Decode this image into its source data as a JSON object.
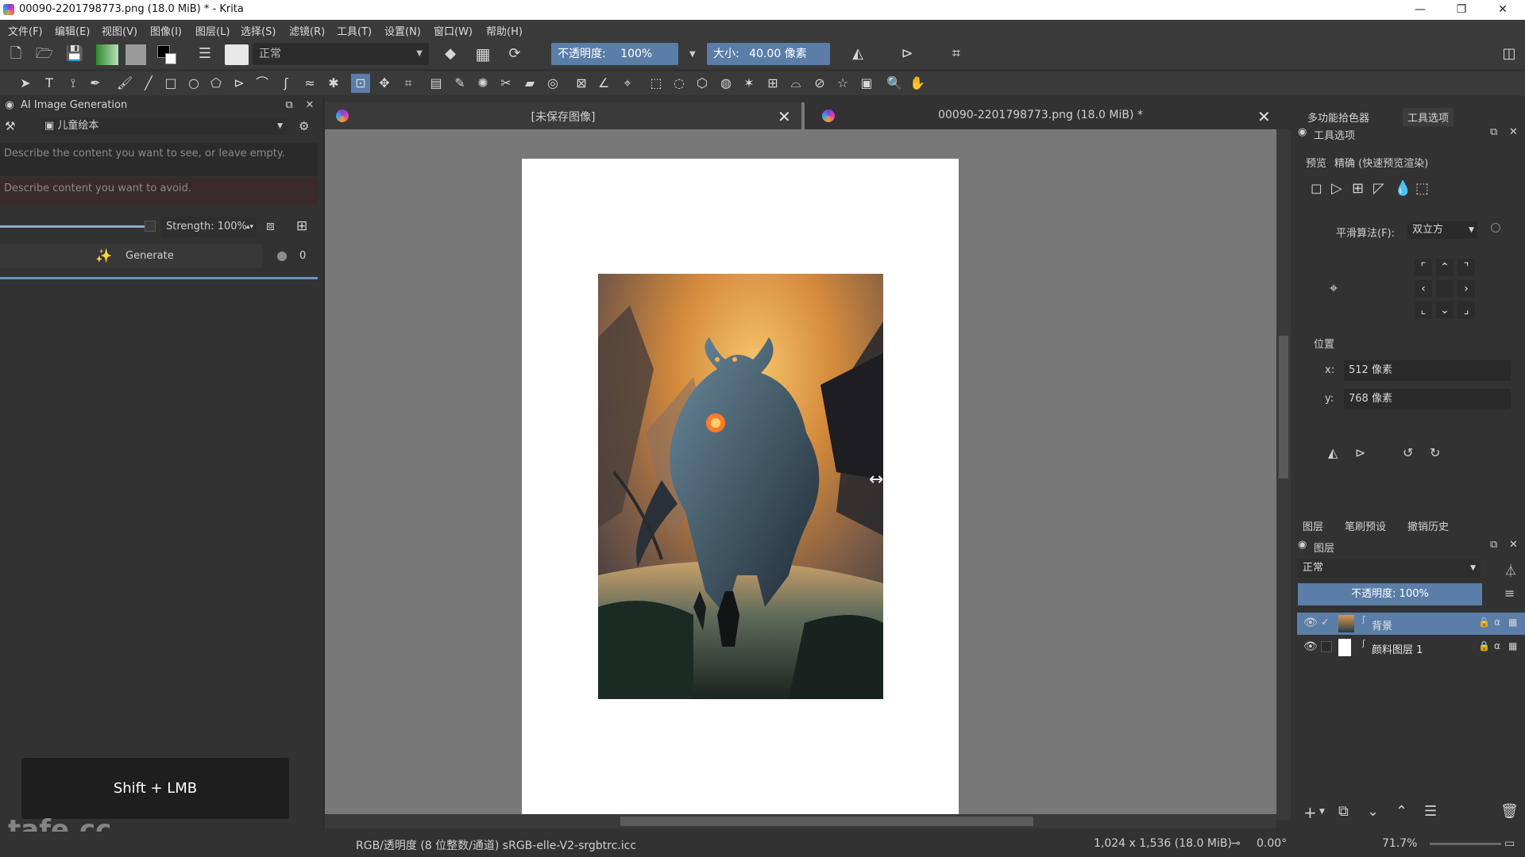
{
  "window": {
    "title": "00090-2201798773.png (18.0 MiB) * - Krita",
    "minimize": "—",
    "maximize": "❐",
    "close": "✕"
  },
  "menu": [
    "文件(F)",
    "编辑(E)",
    "视图(V)",
    "图像(I)",
    "图层(L)",
    "选择(S)",
    "滤镜(R)",
    "工具(T)",
    "设置(N)",
    "窗口(W)",
    "帮助(H)"
  ],
  "toolbar": {
    "blend_mode": "正常",
    "opacity_label": "不透明度:",
    "opacity_value": "100%",
    "size_label": "大小:",
    "size_value": "40.00 像素"
  },
  "ai_docker": {
    "title": "AI Image Generation",
    "style": "儿童绘本",
    "prompt_placeholder": "Describe the content you want to see, or leave empty.",
    "negative_placeholder": "Describe content you want to avoid.",
    "strength": "Strength: 100%",
    "generate": "Generate",
    "count": "0"
  },
  "tabs": [
    {
      "label": "[未保存图像]"
    },
    {
      "label": "00090-2201798773.png (18.0 MiB) *"
    }
  ],
  "right_panel": {
    "tab_color": "多功能拾色器",
    "tab_tool": "工具选项",
    "docker_title": "工具选项",
    "preview_label": "预览",
    "preview_mode": "精确 (快速预览渲染)",
    "filter_label": "平滑算法(F):",
    "filter_value": "双立方",
    "position_label": "位置",
    "x_label": "x:",
    "x_value": "512 像素",
    "y_label": "y:",
    "y_value": "768 像素"
  },
  "layers_panel": {
    "tab_layers": "图层",
    "tab_brush": "笔刷预设",
    "tab_history": "撤销历史",
    "title": "图层",
    "blend_mode": "正常",
    "opacity": "不透明度: 100%",
    "layers": [
      {
        "name": "背景",
        "active": true
      },
      {
        "name": "颜料图层 1",
        "active": false
      }
    ]
  },
  "statusbar": {
    "color_space": "RGB/透明度 (8 位整数/通道)  sRGB-elle-V2-srgbtrc.icc",
    "dimensions": "1,024 x 1,536 (18.0 MiB)",
    "rotation": "0.00°",
    "zoom": "71.7%"
  },
  "hint_text": "Shift + LMB",
  "watermark": "tafe.cc",
  "colors": {
    "accent": "#5a7ea8",
    "canvas_bg": "#787878",
    "panel_bg": "#323232"
  }
}
